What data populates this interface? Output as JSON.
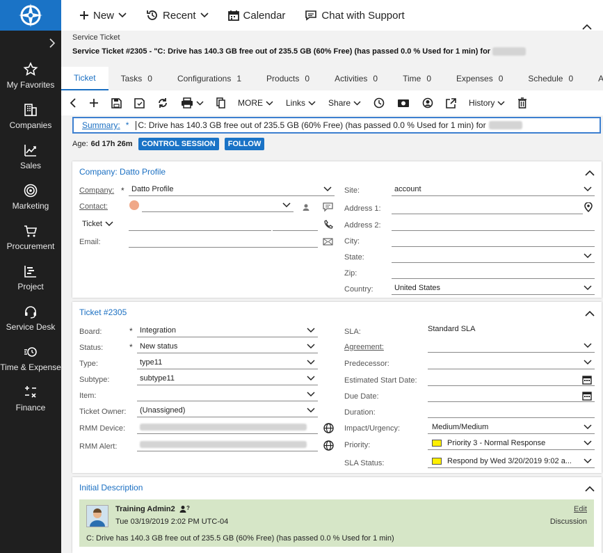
{
  "nav": {
    "expand_icon": "chevron-right-icon",
    "items": [
      {
        "label": "My Favorites",
        "icon": "star-icon"
      },
      {
        "label": "Companies",
        "icon": "building-icon"
      },
      {
        "label": "Sales",
        "icon": "chart-icon"
      },
      {
        "label": "Marketing",
        "icon": "target-icon"
      },
      {
        "label": "Procurement",
        "icon": "cart-icon"
      },
      {
        "label": "Project",
        "icon": "project-icon"
      },
      {
        "label": "Service Desk",
        "icon": "headset-icon"
      },
      {
        "label": "Time & Expense",
        "icon": "clock-icon"
      },
      {
        "label": "Finance",
        "icon": "calculator-icon"
      }
    ]
  },
  "topbar": {
    "new_label": "New",
    "recent_label": "Recent",
    "calendar_label": "Calendar",
    "chat_label": "Chat with Support"
  },
  "breadcrumb": "Service Ticket",
  "ticket_title": "Service Ticket #2305 - \"C: Drive has 140.3 GB free out of 235.5 GB (60% Free) (has passed 0.0 % Used for 1 min) for",
  "tabs": [
    {
      "label": "Ticket",
      "count": ""
    },
    {
      "label": "Tasks",
      "count": "0"
    },
    {
      "label": "Configurations",
      "count": "1"
    },
    {
      "label": "Products",
      "count": "0"
    },
    {
      "label": "Activities",
      "count": "0"
    },
    {
      "label": "Time",
      "count": "0"
    },
    {
      "label": "Expenses",
      "count": "0"
    },
    {
      "label": "Schedule",
      "count": "0"
    },
    {
      "label": "Attachm",
      "count": ""
    }
  ],
  "toolbar": {
    "more_label": "MORE",
    "links_label": "Links",
    "share_label": "Share",
    "history_label": "History"
  },
  "summary": {
    "label": "Summary:",
    "required": "*",
    "value": "C: Drive has 140.3 GB free out of 235.5 GB (60% Free) (has passed 0.0 % Used for 1 min) for"
  },
  "age": {
    "label": "Age:",
    "value": "6d 17h 26m",
    "control_session": "CONTROL SESSION",
    "follow": "FOLLOW"
  },
  "company_card": {
    "title": "Company: Datto Profile",
    "company_label": "Company:",
    "company_value": "Datto Profile",
    "contact_label": "Contact:",
    "contact_value": "",
    "ticket_select": "Ticket",
    "email_label": "Email:",
    "site_label": "Site:",
    "site_value": "account",
    "address1_label": "Address 1:",
    "address2_label": "Address 2:",
    "city_label": "City:",
    "state_label": "State:",
    "zip_label": "Zip:",
    "country_label": "Country:",
    "country_value": "United States",
    "required": "*"
  },
  "ticket_card": {
    "title": "Ticket #2305",
    "board_label": "Board:",
    "board_value": "Integration",
    "status_label": "Status:",
    "status_value": "New status",
    "type_label": "Type:",
    "type_value": "type11",
    "subtype_label": "Subtype:",
    "subtype_value": "subtype11",
    "item_label": "Item:",
    "owner_label": "Ticket Owner:",
    "owner_value": "(Unassigned)",
    "rmm_device_label": "RMM Device:",
    "rmm_alert_label": "RMM Alert:",
    "sla_label": "SLA:",
    "sla_value": "Standard SLA",
    "agreement_label": "Agreement:",
    "predecessor_label": "Predecessor:",
    "est_start_label": "Estimated Start Date:",
    "due_label": "Due Date:",
    "duration_label": "Duration:",
    "impact_label": "Impact/Urgency:",
    "impact_value": "Medium/Medium",
    "priority_label": "Priority:",
    "priority_value": "Priority 3 - Normal Response",
    "sla_status_label": "SLA Status:",
    "sla_status_value": "Respond by Wed 3/20/2019 9:02 a...",
    "required": "*"
  },
  "description_card": {
    "title": "Initial Description",
    "author": "Training Admin2",
    "timestamp": "Tue 03/19/2019 2:02 PM UTC-04",
    "edit": "Edit",
    "type": "Discussion",
    "text": "C: Drive has 140.3 GB free out of 235.5 GB (60% Free) (has passed 0.0 % Used for 1 min)"
  },
  "colors": {
    "accent": "#1a73c6",
    "sidebar": "#1f1f1f",
    "priority": "#ffef00",
    "desc_bg": "#d6e6c7"
  }
}
